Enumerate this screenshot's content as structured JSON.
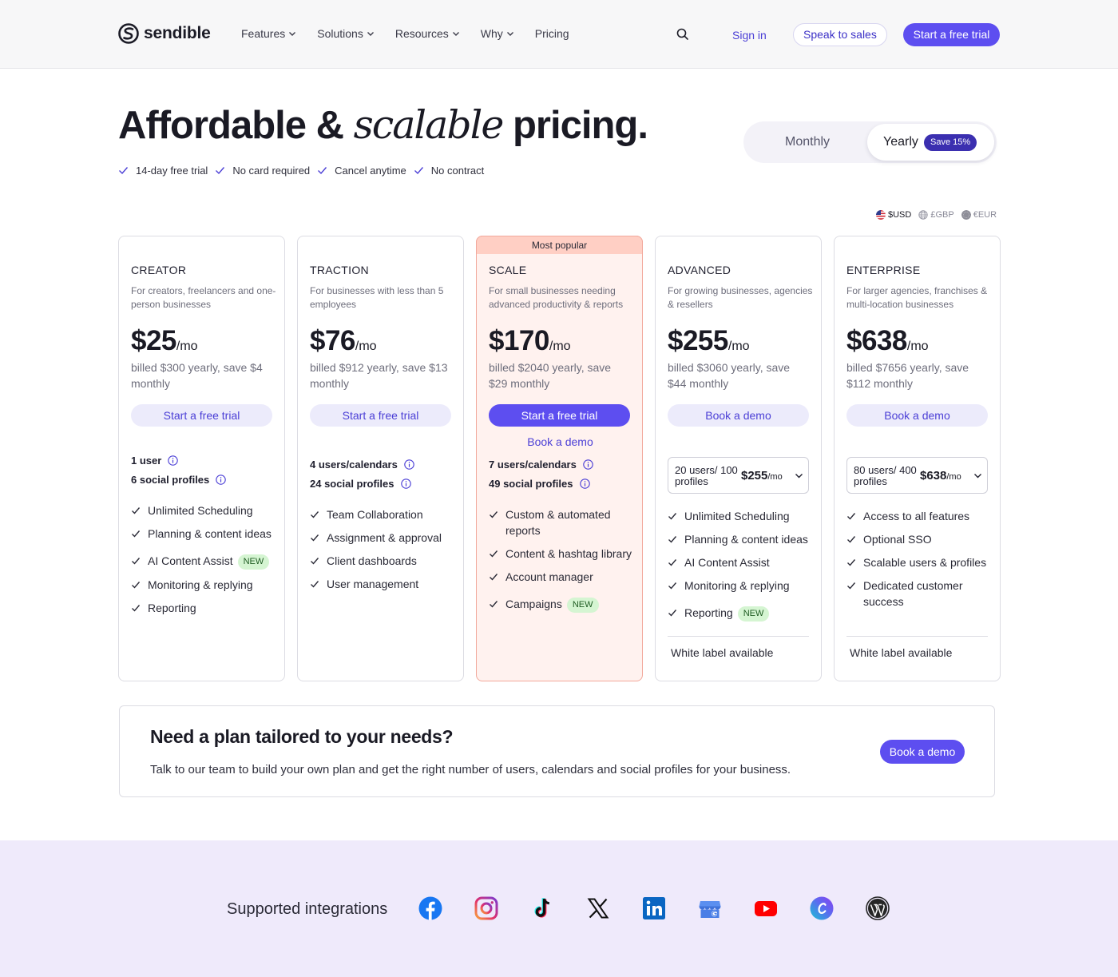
{
  "nav": {
    "logo_text": "sendible",
    "links": [
      {
        "label": "Features",
        "dropdown": true
      },
      {
        "label": "Solutions",
        "dropdown": true
      },
      {
        "label": "Resources",
        "dropdown": true
      },
      {
        "label": "Why",
        "dropdown": true
      },
      {
        "label": "Pricing",
        "dropdown": false
      }
    ],
    "search_icon": "search-icon",
    "sign_in": "Sign in",
    "speak_to_sales": "Speak to sales",
    "start_trial": "Start a free trial"
  },
  "hero": {
    "title_pre": "Affordable & ",
    "title_italic": "scalable",
    "title_post": " pricing.",
    "perks": [
      "14-day free trial",
      "No card required",
      "Cancel anytime",
      "No contract"
    ]
  },
  "billing_toggle": {
    "monthly": "Monthly",
    "yearly": "Yearly",
    "save_badge": "Save 15%",
    "selected": "Yearly"
  },
  "currency": {
    "options": [
      "$USD",
      "£GBP",
      "€EUR"
    ],
    "selected": "$USD"
  },
  "colors": {
    "accent": "#5d4ef0",
    "accent_text": "#4b3fd6",
    "popular_bg": "#fff2ef",
    "popular_band": "#ffcfc4",
    "integrations_bg": "#efeafb",
    "new_badge_bg": "#d5f5d2"
  },
  "plans": {
    "creator": {
      "name": "CREATOR",
      "description": "For creators, freelancers and one-person businesses",
      "price": "$25",
      "per": "/mo",
      "billed": "billed $300 yearly, save $4 monthly",
      "cta": "Start a free trial",
      "users": "1 user",
      "profiles": "6 social profiles",
      "features": [
        "Unlimited Scheduling",
        "Planning & content ideas",
        "AI Content Assist",
        "Monitoring & replying",
        "Reporting"
      ],
      "new_badge": "NEW"
    },
    "traction": {
      "name": "TRACTION",
      "description": "For businesses with less than 5 employees",
      "price": "$76",
      "per": "/mo",
      "billed": "billed $912 yearly, save $13 monthly",
      "cta": "Start a free trial",
      "users": "4 users/calendars",
      "profiles": "24 social profiles",
      "features": [
        "Team Collaboration",
        "Assignment & approval",
        "Client dashboards",
        "User management"
      ]
    },
    "scale": {
      "badge": "Most popular",
      "name": "SCALE",
      "description": "For small businesses needing advanced productivity & reports",
      "price": "$170",
      "per": "/mo",
      "billed": "billed $2040 yearly, save $29 monthly",
      "cta": "Start a free trial",
      "demo": "Book a demo",
      "users": "7 users/calendars",
      "profiles": "49 social profiles",
      "features": [
        "Custom & automated reports",
        "Content & hashtag library",
        "Account manager",
        "Campaigns"
      ],
      "new_badge": "NEW"
    },
    "advanced": {
      "name": "ADVANCED",
      "description": "For growing businesses, agencies & resellers",
      "price": "$255",
      "per": "/mo",
      "billed": "billed $3060 yearly, save $44 monthly",
      "cta": "Book a demo",
      "select_users": "20 users/ 100 profiles",
      "select_price": "$255",
      "select_per": "/mo",
      "features": [
        "Unlimited Scheduling",
        "Planning & content ideas",
        "AI Content Assist",
        "Monitoring & replying",
        "Reporting"
      ],
      "new_badge": "NEW",
      "white_label": "White label available"
    },
    "enterprise": {
      "name": "ENTERPRISE",
      "description": "For larger agencies, franchises & multi-location businesses",
      "price": "$638",
      "per": "/mo",
      "billed": "billed $7656 yearly, save $112 monthly",
      "cta": "Book a demo",
      "select_users": "80 users/ 400 profiles",
      "select_price": "$638",
      "select_per": "/mo",
      "features": [
        "Access to all features",
        "Optional SSO",
        "Scalable users & profiles",
        "Dedicated customer success"
      ],
      "white_label": "White label available"
    }
  },
  "tailored": {
    "title": "Need a plan tailored to your needs?",
    "text": "Talk to our team to build your own plan and get the right number of users, calendars and social profiles for your business.",
    "button": "Book a demo"
  },
  "integrations": {
    "label": "Supported integrations",
    "icons": [
      "facebook-icon",
      "instagram-icon",
      "tiktok-icon",
      "x-icon",
      "linkedin-icon",
      "google-business-icon",
      "youtube-icon",
      "canva-icon",
      "wordpress-icon"
    ]
  }
}
